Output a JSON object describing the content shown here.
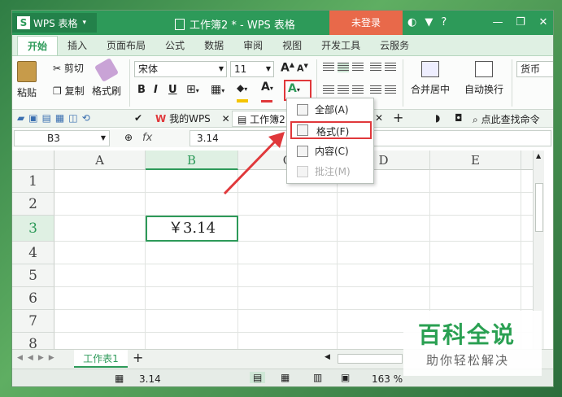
{
  "titlebar": {
    "app_name": "WPS 表格",
    "app_logo": "S",
    "doc_title": "工作簿2 * - WPS 表格",
    "login": "未登录",
    "icons": [
      "skin-icon",
      "shirt-icon",
      "help-icon"
    ],
    "help": "?",
    "caret": "▾",
    "minimize": "—",
    "restore": "❐",
    "close": "✕"
  },
  "tabs": [
    "开始",
    "插入",
    "页面布局",
    "公式",
    "数据",
    "审阅",
    "视图",
    "开发工具",
    "云服务"
  ],
  "ribbon": {
    "paste": "粘贴",
    "cut": "剪切",
    "copy": "复制",
    "format_painter": "格式刷",
    "font_name": "宋体",
    "font_size": "11",
    "bold": "B",
    "italic": "I",
    "underline": "U",
    "merge_center": "合并居中",
    "wrap_text": "自动换行",
    "currency": "货币",
    "grow_font": "A",
    "shrink_font": "A",
    "font_color_letter": "A",
    "clear_letter": "A"
  },
  "quick_access": {
    "doc_tabs": [
      "我的WPS",
      "工作簿2"
    ],
    "add_tab": "+",
    "search": "点此查找命令"
  },
  "formula_bar": {
    "cell_ref": "B3",
    "fx": "fx",
    "value": "3.14"
  },
  "grid": {
    "columns": [
      "A",
      "B",
      "C",
      "D",
      "E"
    ],
    "rows": [
      "1",
      "2",
      "3",
      "4",
      "5",
      "6",
      "7",
      "8"
    ],
    "selected_cell_value": "￥3.14"
  },
  "clear_menu": {
    "items": [
      {
        "label": "全部(A)",
        "disabled": false
      },
      {
        "label": "格式(F)",
        "disabled": false
      },
      {
        "label": "内容(C)",
        "disabled": false
      },
      {
        "label": "批注(M)",
        "disabled": true
      }
    ]
  },
  "sheets": {
    "tab": "工作表1",
    "add": "+"
  },
  "status": {
    "value": "3.14",
    "zoom": "163 %"
  },
  "watermark": {
    "title": "百科全说",
    "subtitle": "助你轻松解决"
  },
  "colors": {
    "accent": "#2d9a59",
    "highlight": "#e0383b",
    "login": "#e8694a"
  }
}
